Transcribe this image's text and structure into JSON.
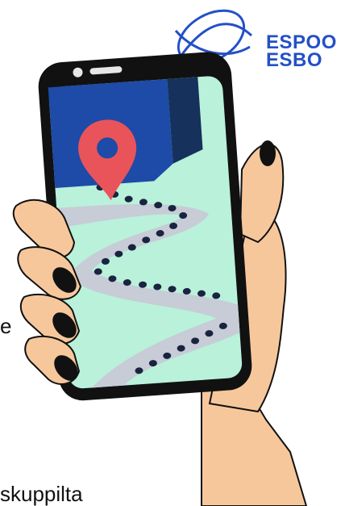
{
  "logo": {
    "line1": "ESPOO",
    "line2": "ESBO",
    "color": "#2350c7"
  },
  "partial_texts": {
    "left_fragment": "e",
    "bottom_fragment": "skuppilta"
  },
  "illustration": {
    "subject": "hand-holding-phone-with-map",
    "pin_color": "#e9545a",
    "map_color": "#b9f1da",
    "skin_color": "#f7c79c",
    "nail_color": "#111111",
    "phone_color": "#111111",
    "building_color": "#1e4aa8",
    "road_color": "#c7ccd6"
  }
}
